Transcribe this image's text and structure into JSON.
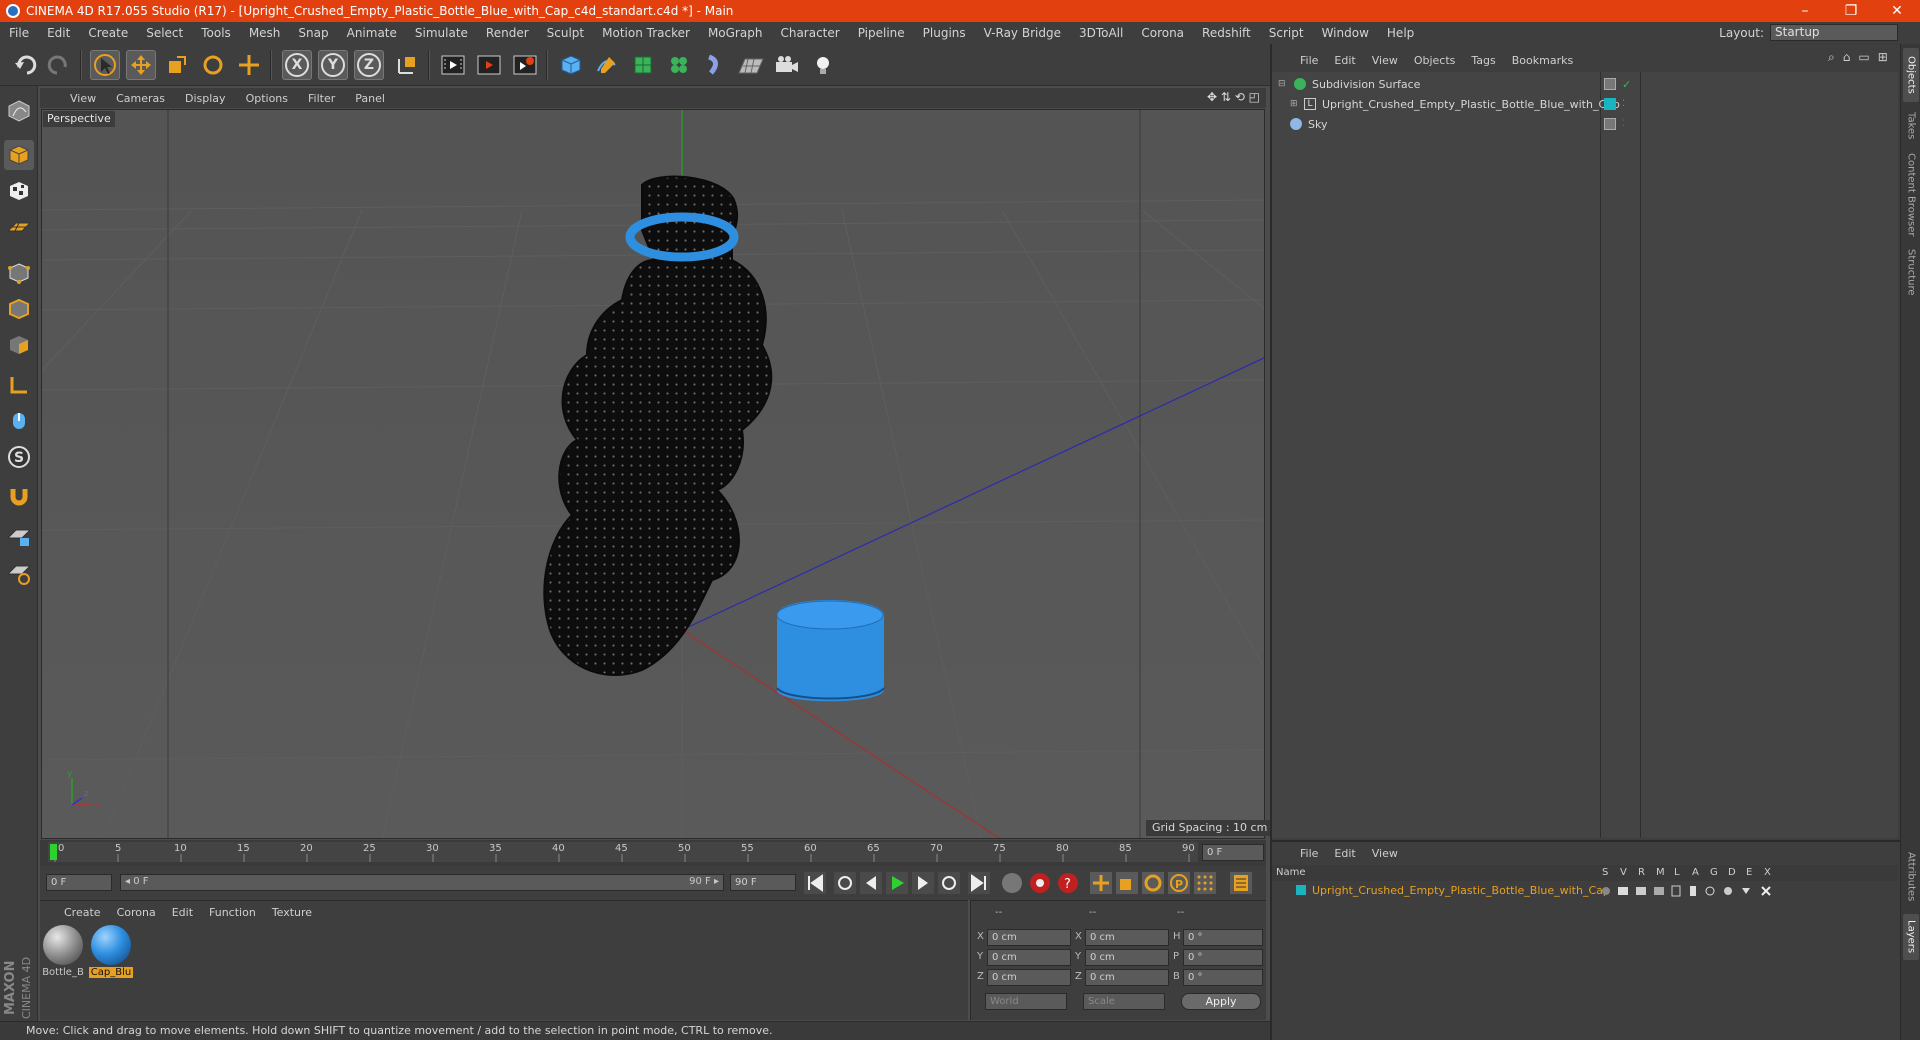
{
  "window": {
    "title": "CINEMA 4D R17.055 Studio (R17) - [Upright_Crushed_Empty_Plastic_Bottle_Blue_with_Cap_c4d_standart.c4d *] - Main",
    "minimize": "–",
    "restore": "❐",
    "close": "✕"
  },
  "menubar": {
    "items": [
      "File",
      "Edit",
      "Create",
      "Select",
      "Tools",
      "Mesh",
      "Snap",
      "Animate",
      "Simulate",
      "Render",
      "Sculpt",
      "Motion Tracker",
      "MoGraph",
      "Character",
      "Pipeline",
      "Plugins",
      "V-Ray Bridge",
      "3DToAll",
      "Corona",
      "Redshift",
      "Script",
      "Window",
      "Help"
    ],
    "layout_label": "Layout:",
    "layout_value": "Startup"
  },
  "toolbar": {
    "axis_x": "X",
    "axis_y": "Y",
    "axis_z": "Z"
  },
  "viewport": {
    "menu": [
      "View",
      "Cameras",
      "Display",
      "Options",
      "Filter",
      "Panel"
    ],
    "label": "Perspective",
    "grid_spacing": "Grid Spacing : 10 cm",
    "nav_icons": "✥ ⇅ ⟲ ◰"
  },
  "timeline": {
    "ticks": [
      "0",
      "5",
      "10",
      "15",
      "20",
      "25",
      "30",
      "35",
      "40",
      "45",
      "50",
      "55",
      "60",
      "65",
      "70",
      "75",
      "80",
      "85",
      "90"
    ],
    "current_frame": "0 F",
    "start_frame": "0 F",
    "range_start": "◂ 0 F",
    "range_end": "90 F ▸",
    "end_frame": "90 F"
  },
  "materials": {
    "menu": [
      "Create",
      "Corona",
      "Edit",
      "Function",
      "Texture"
    ],
    "items": [
      {
        "name": "Bottle_B"
      },
      {
        "name": "Cap_Blu"
      }
    ]
  },
  "coordinates": {
    "header": [
      "--",
      "--",
      "--"
    ],
    "rows": [
      {
        "l1": "X",
        "v1": "0 cm",
        "l2": "X",
        "v2": "0 cm",
        "l3": "H",
        "v3": "0 °"
      },
      {
        "l1": "Y",
        "v1": "0 cm",
        "l2": "Y",
        "v2": "0 cm",
        "l3": "P",
        "v3": "0 °"
      },
      {
        "l1": "Z",
        "v1": "0 cm",
        "l2": "Z",
        "v2": "0 cm",
        "l3": "B",
        "v3": "0 °"
      }
    ],
    "mode": "World",
    "type": "Scale",
    "apply": "Apply"
  },
  "status": "Move: Click and drag to move elements. Hold down SHIFT to quantize movement / add to the selection in point mode, CTRL to remove.",
  "objects": {
    "menu": [
      "File",
      "Edit",
      "View",
      "Objects",
      "Tags",
      "Bookmarks"
    ],
    "items": [
      {
        "name": "Subdivision Surface"
      },
      {
        "name": "Upright_Crushed_Empty_Plastic_Bottle_Blue_with_Cap"
      },
      {
        "name": "Sky"
      }
    ]
  },
  "layers": {
    "menu": [
      "File",
      "Edit",
      "View"
    ],
    "header_name": "Name",
    "header_cols": [
      "S",
      "V",
      "R",
      "M",
      "L",
      "A",
      "G",
      "D",
      "E",
      "X"
    ],
    "row_name": "Upright_Crushed_Empty_Plastic_Bottle_Blue_with_Cap"
  },
  "right_tabs": [
    "Objects",
    "Takes",
    "Content Browser",
    "Structure",
    "Attributes",
    "Layers"
  ],
  "colors": {
    "title_bg": "#e2410f",
    "accent_orange": "#e8a020",
    "cap_blue": "#2e8fe0",
    "bottle": "#111111"
  }
}
